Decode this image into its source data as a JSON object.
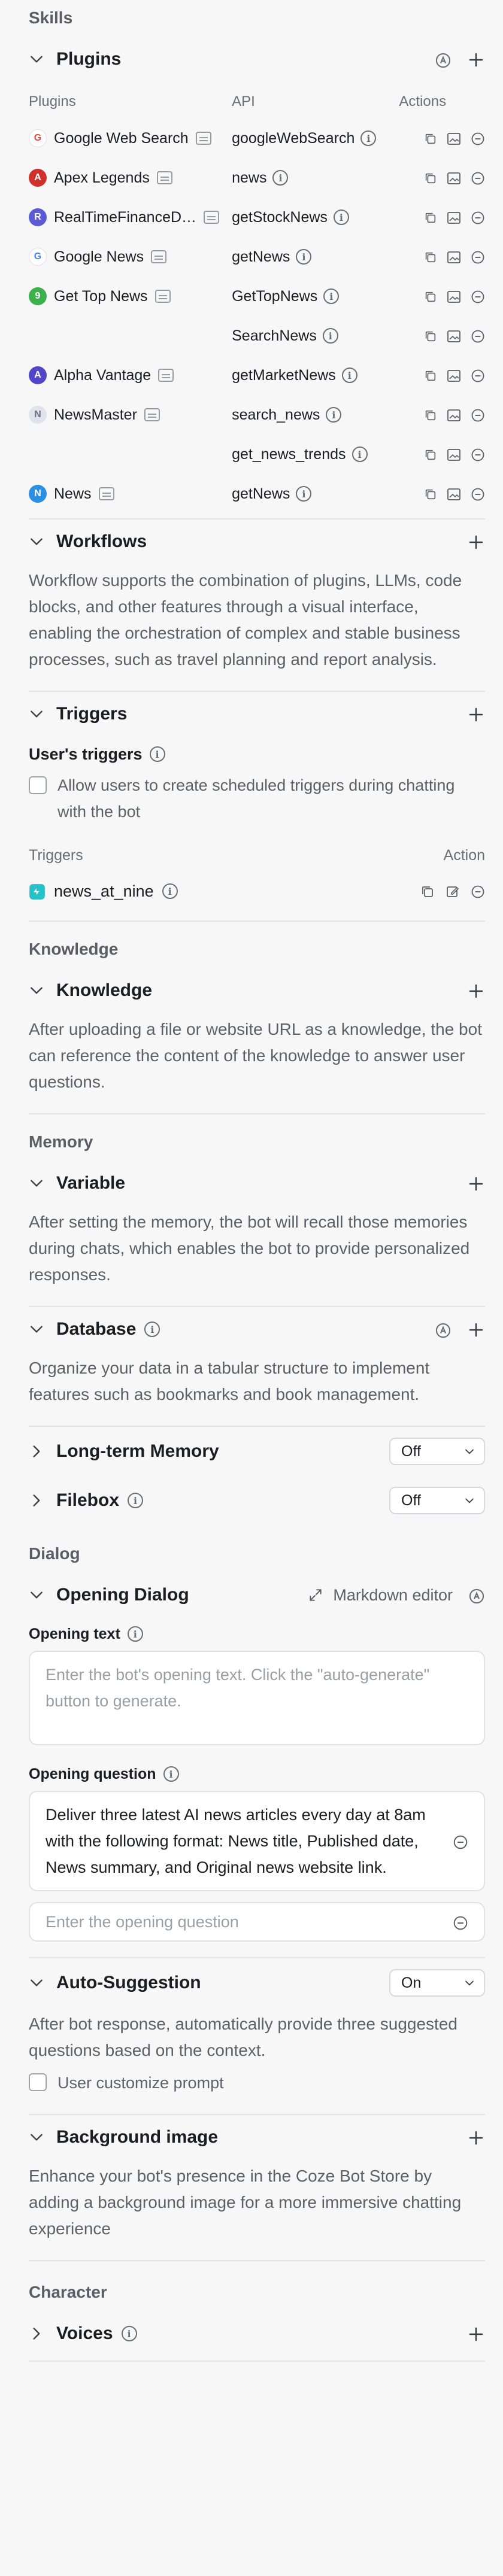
{
  "skills": {
    "group_title": "Skills",
    "plugins": {
      "title": "Plugins",
      "columns": {
        "plugins": "Plugins",
        "api": "API",
        "actions": "Actions"
      },
      "rows": [
        {
          "name": "Google Web Search",
          "api": "googleWebSearch",
          "logo": "G",
          "logo_color": "#ffffff",
          "logo_text_color": "#ea4335",
          "show_name": true
        },
        {
          "name": "Apex Legends",
          "api": "news",
          "logo": "A",
          "logo_color": "#d0312d",
          "logo_text_color": "#ffffff",
          "show_name": true
        },
        {
          "name": "RealTimeFinanceD…",
          "api": "getStockNews",
          "logo": "R",
          "logo_color": "#5b5bd6",
          "logo_text_color": "#ffffff",
          "show_name": true
        },
        {
          "name": "Google News",
          "api": "getNews",
          "logo": "G",
          "logo_color": "#ffffff",
          "logo_text_color": "#4285f4",
          "show_name": true
        },
        {
          "name": "Get Top News",
          "api": "GetTopNews",
          "logo": "9",
          "logo_color": "#3cb04a",
          "logo_text_color": "#ffffff",
          "show_name": true
        },
        {
          "name": "",
          "api": "SearchNews",
          "logo": "",
          "logo_color": "",
          "logo_text_color": "",
          "show_name": false
        },
        {
          "name": "Alpha Vantage",
          "api": "getMarketNews",
          "logo": "A",
          "logo_color": "#5046c8",
          "logo_text_color": "#ffffff",
          "show_name": true
        },
        {
          "name": "NewsMaster",
          "api": "search_news",
          "logo": "N",
          "logo_color": "#dfe3ec",
          "logo_text_color": "#6b7080",
          "show_name": true
        },
        {
          "name": "",
          "api": "get_news_trends",
          "logo": "",
          "logo_color": "",
          "logo_text_color": "",
          "show_name": false
        },
        {
          "name": "News",
          "api": "getNews",
          "logo": "N",
          "logo_color": "#2b8fe6",
          "logo_text_color": "#ffffff",
          "show_name": true
        }
      ]
    },
    "workflows": {
      "title": "Workflows",
      "description": "Workflow supports the combination of plugins, LLMs, code blocks, and other features through a visual interface, enabling the orchestration of complex and stable business processes, such as travel planning and report analysis."
    },
    "triggers": {
      "title": "Triggers",
      "users_triggers_label": "User's triggers",
      "allow_label": "Allow users to create scheduled triggers during chatting with the bot",
      "columns": {
        "triggers": "Triggers",
        "action": "Action"
      },
      "rows": [
        {
          "name": "news_at_nine"
        }
      ]
    }
  },
  "knowledge": {
    "group_title": "Knowledge",
    "title": "Knowledge",
    "description": "After uploading a file or website URL as a knowledge, the bot can reference the content of the knowledge to answer user questions."
  },
  "memory": {
    "group_title": "Memory",
    "variable": {
      "title": "Variable",
      "description": "After setting the memory, the bot will recall those memories during chats, which enables the bot to provide personalized responses."
    },
    "database": {
      "title": "Database",
      "description": "Organize your data in a tabular structure to implement features such as bookmarks and book management."
    },
    "long_term": {
      "title": "Long-term Memory",
      "value": "Off"
    },
    "filebox": {
      "title": "Filebox",
      "value": "Off"
    }
  },
  "dialog": {
    "group_title": "Dialog",
    "opening": {
      "title": "Opening Dialog",
      "markdown_label": "Markdown editor",
      "opening_text_label": "Opening text",
      "opening_text_placeholder": "Enter the bot's opening text. Click the \"auto-generate\" button to generate.",
      "opening_question_label": "Opening question",
      "question_value": "Deliver three latest AI news articles every day at 8am with the following format: News title, Published date, News summary, and Original news website link.",
      "question_placeholder": "Enter the opening question"
    },
    "auto_suggestion": {
      "title": "Auto-Suggestion",
      "value": "On",
      "description": "After bot response, automatically provide three suggested questions based on the context.",
      "customize_label": "User customize prompt"
    },
    "background": {
      "title": "Background image",
      "description": "Enhance your bot's presence in the Coze Bot Store by adding a background image for a more immersive chatting experience"
    }
  },
  "character": {
    "group_title": "Character",
    "voices": {
      "title": "Voices"
    }
  }
}
